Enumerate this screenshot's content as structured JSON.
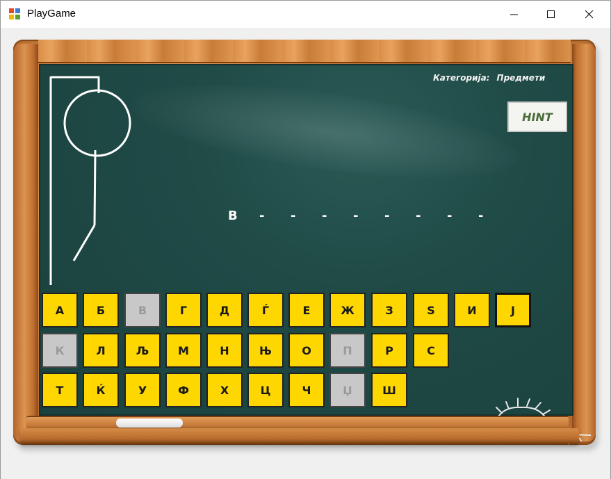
{
  "window": {
    "title": "PlayGame",
    "controls": {
      "minimize_icon": "minimize-icon",
      "maximize_icon": "maximize-icon",
      "close_icon": "close-icon"
    }
  },
  "board": {
    "category_label": "Категорија:",
    "category_value": "Предмети",
    "hint_label": "HINT",
    "word_slots": [
      "В",
      "-",
      "-",
      "-",
      "-",
      "-",
      "-",
      "-",
      "-"
    ],
    "hangman_stage": "head-body-leg"
  },
  "keyboard": {
    "rows": [
      [
        {
          "label": "А",
          "state": "available"
        },
        {
          "label": "Б",
          "state": "available"
        },
        {
          "label": "В",
          "state": "used"
        },
        {
          "label": "Г",
          "state": "available"
        },
        {
          "label": "Д",
          "state": "available"
        },
        {
          "label": "Ѓ",
          "state": "available"
        },
        {
          "label": "Е",
          "state": "available"
        },
        {
          "label": "Ж",
          "state": "available"
        },
        {
          "label": "З",
          "state": "available"
        },
        {
          "label": "Ѕ",
          "state": "available"
        },
        {
          "label": "И",
          "state": "available"
        },
        {
          "label": "Ј",
          "state": "selected"
        }
      ],
      [
        {
          "label": "К",
          "state": "used"
        },
        {
          "label": "Л",
          "state": "available"
        },
        {
          "label": "Љ",
          "state": "available"
        },
        {
          "label": "М",
          "state": "available"
        },
        {
          "label": "Н",
          "state": "available"
        },
        {
          "label": "Њ",
          "state": "available"
        },
        {
          "label": "О",
          "state": "available"
        },
        {
          "label": "П",
          "state": "used"
        },
        {
          "label": "Р",
          "state": "available"
        },
        {
          "label": "С",
          "state": "available"
        }
      ],
      [
        {
          "label": "Т",
          "state": "available"
        },
        {
          "label": "Ќ",
          "state": "available"
        },
        {
          "label": "У",
          "state": "available"
        },
        {
          "label": "Ф",
          "state": "available"
        },
        {
          "label": "Х",
          "state": "available"
        },
        {
          "label": "Ц",
          "state": "available"
        },
        {
          "label": "Ч",
          "state": "available"
        },
        {
          "label": "Џ",
          "state": "used"
        },
        {
          "label": "Ш",
          "state": "available"
        }
      ]
    ]
  },
  "colors": {
    "board": "#1f4a46",
    "key_available": "#ffd700",
    "key_used": "#c8c8c8",
    "chalk": "#ffffff",
    "frame_wood": "#c97a35"
  }
}
